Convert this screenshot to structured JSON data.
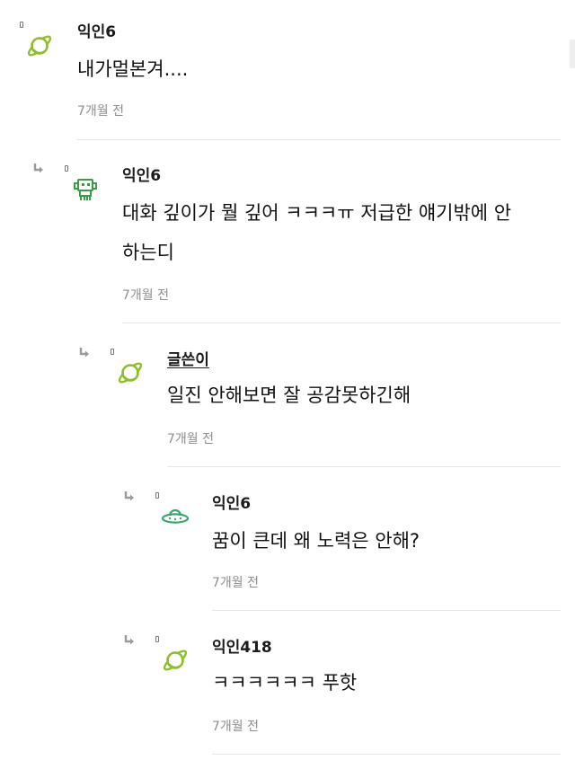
{
  "comments": [
    {
      "author": "익인6",
      "avatar_icon": "planet-icon",
      "lines": [
        "내가멀본겨...."
      ],
      "time": "7개월 전",
      "depth": 0
    },
    {
      "author": "익인6",
      "avatar_icon": "space-invader-icon",
      "lines": [
        "대화 깊이가 뭘 깊어 ㅋㅋㅋㅠ 저급한 얘기밖에 안",
        "하는디"
      ],
      "time": "7개월 전",
      "depth": 1
    },
    {
      "author": "글쓴이",
      "avatar_icon": "planet-icon",
      "lines": [
        "일진 안해보면 잘 공감못하긴해"
      ],
      "time": "7개월 전",
      "depth": 2
    },
    {
      "author": "익인6",
      "avatar_icon": "ufo-icon",
      "lines": [
        "꿈이 큰데 왜 노력은 안해?"
      ],
      "time": "7개월 전",
      "depth": 3
    },
    {
      "author": "익인418",
      "avatar_icon": "planet-icon",
      "lines": [
        "ㅋㅋㅋㅋㅋㅋ 푸핫"
      ],
      "time": "7개월 전",
      "depth": 3
    }
  ],
  "colors": {
    "avatar_green": "#8dbf2a",
    "ufo_green": "#35a86b",
    "text": "#111111",
    "time": "#8e8e8e",
    "divider": "#e6e6e6",
    "reply_arrow": "#9a9a9a"
  }
}
